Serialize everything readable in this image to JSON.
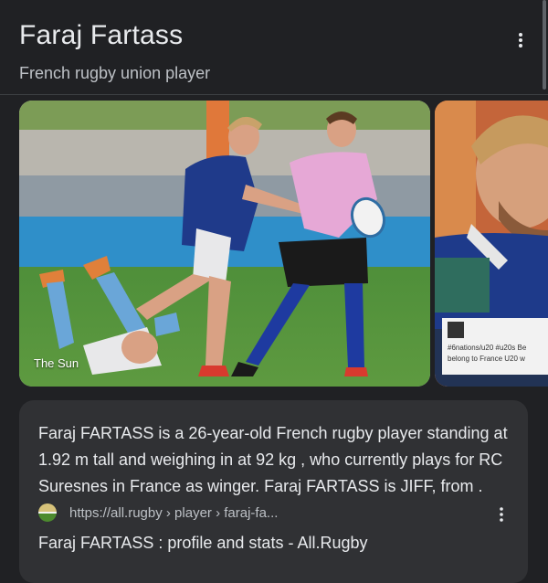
{
  "header": {
    "title": "Faraj Fartass",
    "subtitle": "French rugby union player"
  },
  "images": {
    "main": {
      "caption": "The Sun"
    },
    "side": {
      "overlay_line1": "#6nations/u20 #u20s Be",
      "overlay_line2": "belong to France U20 w"
    }
  },
  "snippet": {
    "text": "Faraj FARTASS is a 26-year-old French rugby player standing at 1.92 m tall and weighing in at 92 kg , who currently plays for RC Suresnes in France as winger. Faraj FARTASS is JIFF, from .",
    "source_url": "https://all.rugby › player › faraj-fa...",
    "result_title": "Faraj FARTASS : profile and stats - All.Rugby"
  },
  "colors": {
    "background": "#202124",
    "card": "#303134",
    "primary_text": "#e8eaed",
    "secondary_text": "#bdc1c6"
  }
}
